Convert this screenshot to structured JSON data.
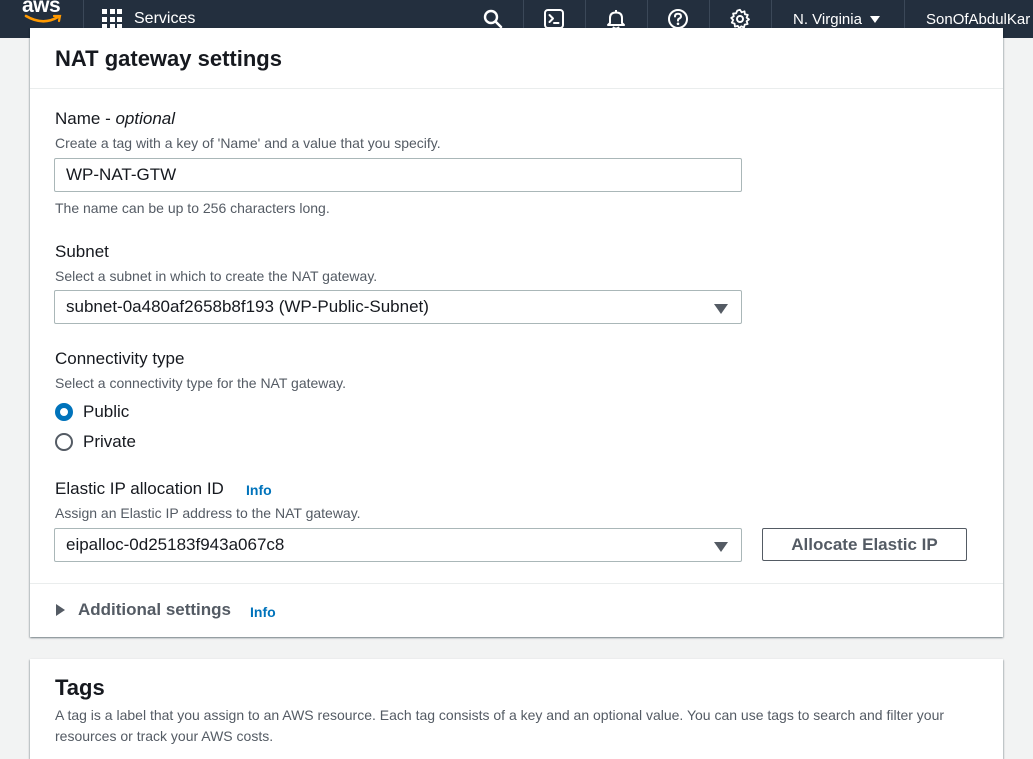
{
  "topbar": {
    "logo_text": "aws",
    "services_label": "Services",
    "icons": [
      "search-icon",
      "cloudshell-icon",
      "notifications-icon",
      "help-icon",
      "settings-icon"
    ],
    "region": "N. Virginia",
    "account": "SonOfAbdulKar"
  },
  "nat_settings": {
    "title": "NAT gateway settings",
    "name": {
      "label": "Name - ",
      "label_optional": "optional",
      "description": "Create a tag with a key of 'Name' and a value that you specify.",
      "value": "WP-NAT-GTW",
      "constraint": "The name can be up to 256 characters long."
    },
    "subnet": {
      "label": "Subnet",
      "description": "Select a subnet in which to create the NAT gateway.",
      "selected": "subnet-0a480af2658b8f193 (WP-Public-Subnet)"
    },
    "connectivity": {
      "label": "Connectivity type",
      "description": "Select a connectivity type for the NAT gateway.",
      "options": [
        "Public",
        "Private"
      ],
      "selected": "Public"
    },
    "elastic_ip": {
      "label": "Elastic IP allocation ID",
      "info": "Info",
      "description": "Assign an Elastic IP address to the NAT gateway.",
      "selected": "eipalloc-0d25183f943a067c8",
      "allocate_button": "Allocate Elastic IP"
    },
    "additional_settings": {
      "label": "Additional settings",
      "info": "Info"
    }
  },
  "tags": {
    "title": "Tags",
    "description": "A tag is a label that you assign to an AWS resource. Each tag consists of a key and an optional value. You can use tags to search and filter your resources or track your AWS costs."
  },
  "colors": {
    "topbar_bg": "#232f3e",
    "accent": "#0073bb",
    "page_bg": "#f2f3f3"
  }
}
